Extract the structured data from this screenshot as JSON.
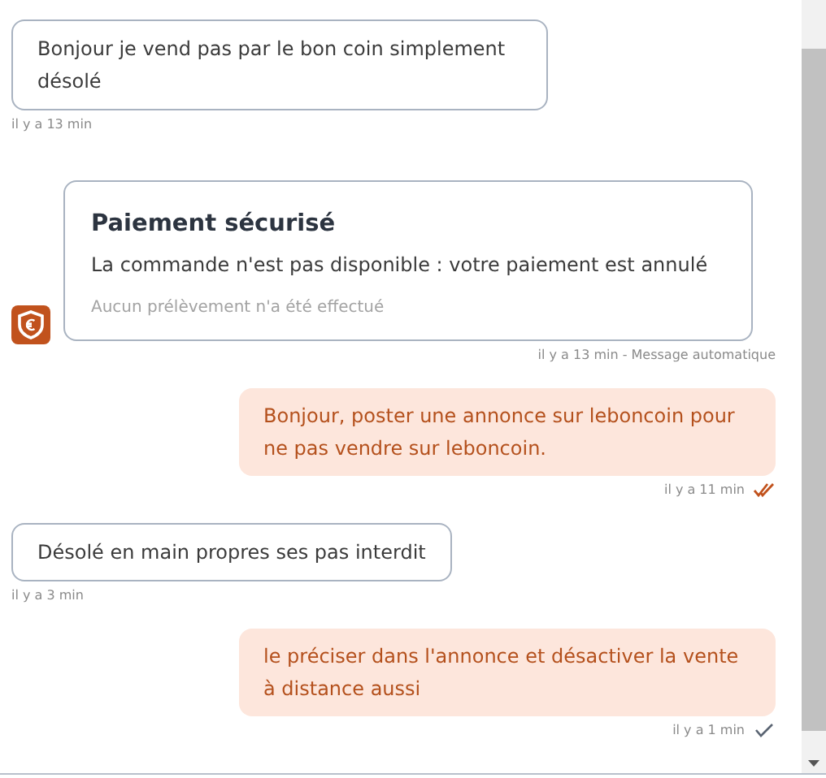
{
  "messages": [
    {
      "kind": "received",
      "text": "Bonjour je vend pas par le bon coin simplement désolé",
      "time": "il y a 13 min"
    },
    {
      "kind": "system",
      "title": "Paiement sécurisé",
      "text": "La commande n'est pas disponible : votre paiement est annulé",
      "note": "Aucun prélèvement n'a été effectué",
      "time": "il y a 13 min - Message automatique"
    },
    {
      "kind": "sent",
      "text": "Bonjour, poster une annonce sur leboncoin pour ne pas vendre sur leboncoin.",
      "time": "il y a 11 min",
      "read": true
    },
    {
      "kind": "received",
      "text": "Désolé en main propres ses pas interdit",
      "time": "il y a 3 min"
    },
    {
      "kind": "sent",
      "text": "le préciser dans l'annonce et désactiver la vente à distance aussi",
      "time": "il y a 1 min",
      "read": false
    }
  ]
}
